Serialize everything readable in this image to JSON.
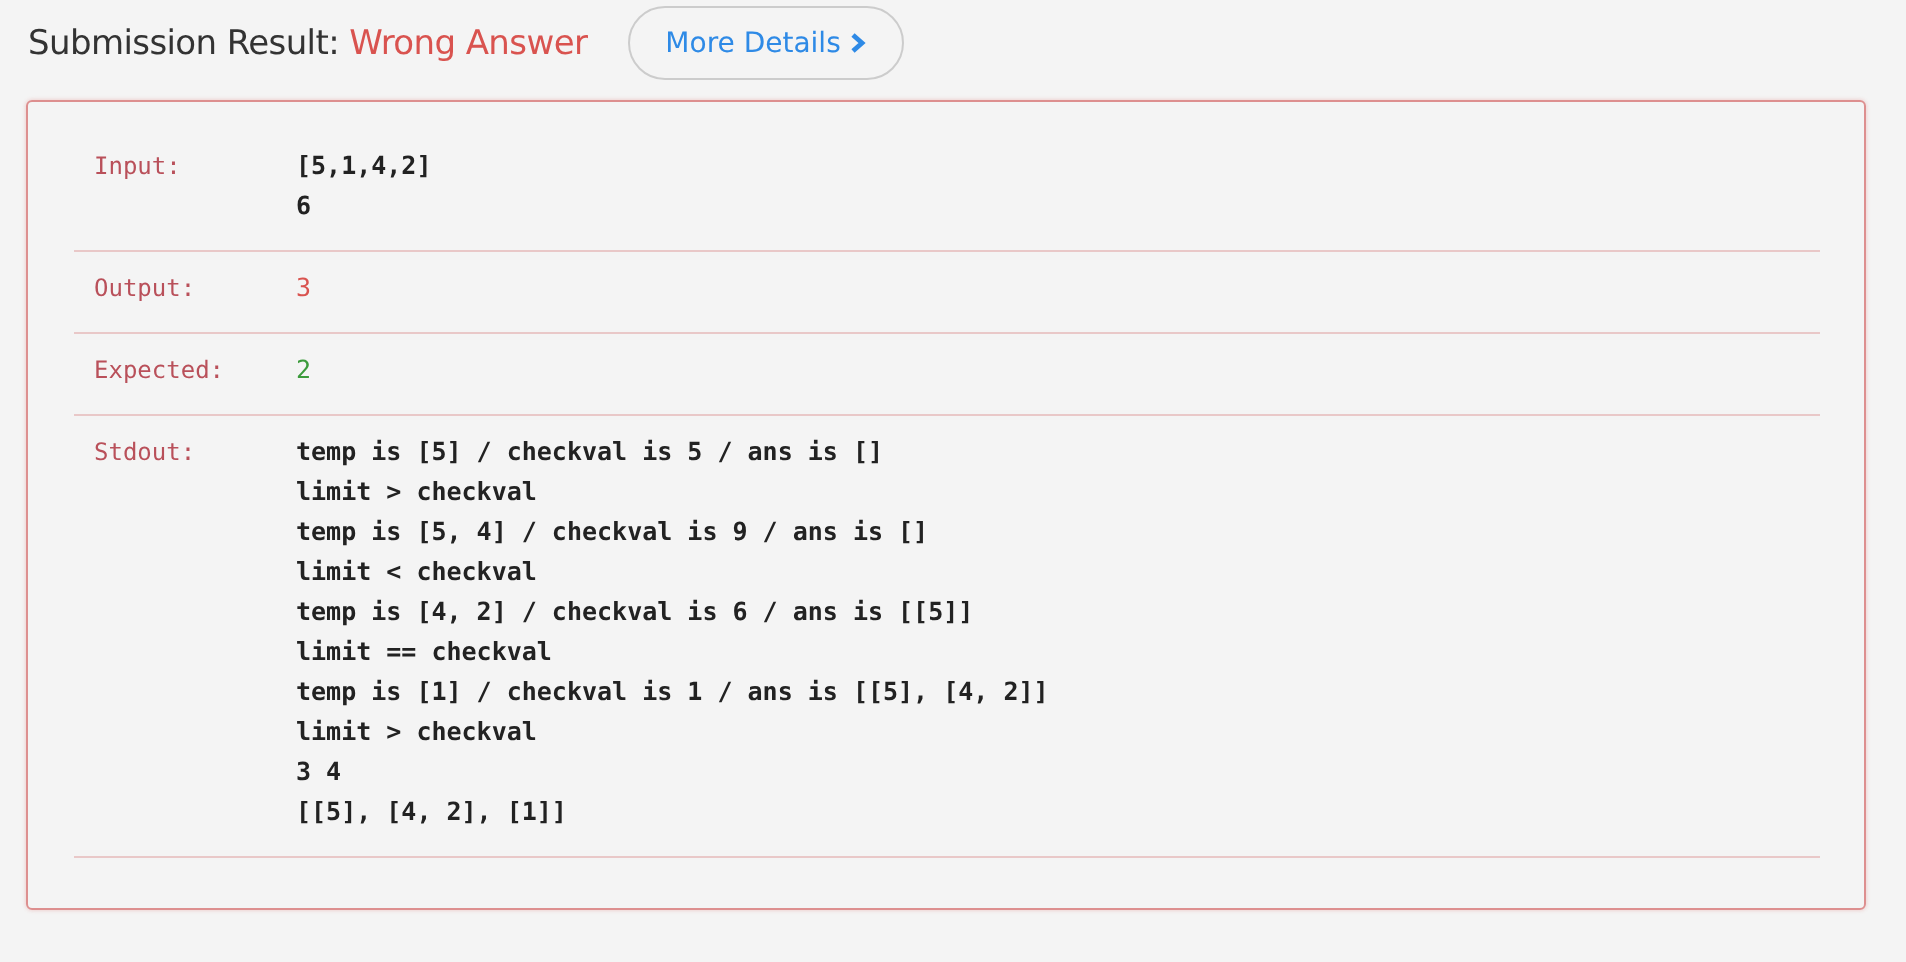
{
  "header": {
    "title": "Submission Result:",
    "status": "Wrong Answer",
    "details_button": "More Details"
  },
  "rows": [
    {
      "label": "Input:",
      "kind": "plain",
      "lines": [
        "[5,1,4,2]",
        "6"
      ]
    },
    {
      "label": "Output:",
      "kind": "wrong",
      "lines": [
        "3"
      ]
    },
    {
      "label": "Expected:",
      "kind": "correct",
      "lines": [
        "2"
      ]
    },
    {
      "label": "Stdout:",
      "kind": "plain",
      "lines": [
        "temp is [5] / checkval is 5 / ans is []",
        "limit > checkval",
        "temp is [5, 4] / checkval is 9 / ans is []",
        "limit < checkval",
        "temp is [4, 2] / checkval is 6 / ans is [[5]]",
        "limit == checkval",
        "temp is [1] / checkval is 1 / ans is [[5], [4, 2]]",
        "limit > checkval",
        "3 4",
        "[[5], [4, 2], [1]]"
      ]
    }
  ]
}
